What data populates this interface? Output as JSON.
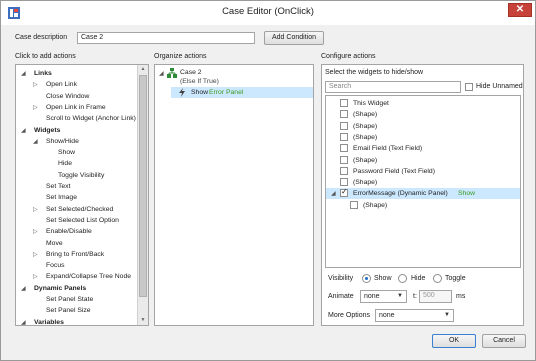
{
  "window": {
    "title": "Case Editor (OnClick)"
  },
  "case": {
    "description_label": "Case description",
    "description_value": "Case 2",
    "add_condition_label": "Add Condition"
  },
  "columns": {
    "left": "Click to add actions",
    "middle": "Organize actions",
    "right": "Configure actions"
  },
  "actions_tree": [
    {
      "label": "Links",
      "bold": true,
      "expander": "◢",
      "indent": 0
    },
    {
      "label": "Open Link",
      "expander": "▷",
      "indent": 1
    },
    {
      "label": "Close Window",
      "indent": 1
    },
    {
      "label": "Open Link in Frame",
      "expander": "▷",
      "indent": 1
    },
    {
      "label": "Scroll to Widget (Anchor Link)",
      "indent": 1
    },
    {
      "label": "Widgets",
      "bold": true,
      "expander": "◢",
      "indent": 0
    },
    {
      "label": "Show/Hide",
      "expander": "◢",
      "indent": 1
    },
    {
      "label": "Show",
      "indent": 2
    },
    {
      "label": "Hide",
      "indent": 2
    },
    {
      "label": "Toggle Visibility",
      "indent": 2
    },
    {
      "label": "Set Text",
      "indent": 1
    },
    {
      "label": "Set Image",
      "indent": 1
    },
    {
      "label": "Set Selected/Checked",
      "expander": "▷",
      "indent": 1
    },
    {
      "label": "Set Selected List Option",
      "indent": 1
    },
    {
      "label": "Enable/Disable",
      "expander": "▷",
      "indent": 1
    },
    {
      "label": "Move",
      "indent": 1
    },
    {
      "label": "Bring to Front/Back",
      "expander": "▷",
      "indent": 1
    },
    {
      "label": "Focus",
      "indent": 1
    },
    {
      "label": "Expand/Collapse Tree Node",
      "expander": "▷",
      "indent": 1
    },
    {
      "label": "Dynamic Panels",
      "bold": true,
      "expander": "◢",
      "indent": 0
    },
    {
      "label": "Set Panel State",
      "indent": 1
    },
    {
      "label": "Set Panel Size",
      "indent": 1
    },
    {
      "label": "Variables",
      "bold": true,
      "expander": "◢",
      "indent": 0
    }
  ],
  "organize": {
    "case_label": "Case 2",
    "case_sub": "(Else If True)",
    "action_verb": "Show",
    "action_target": "Error Panel"
  },
  "configure": {
    "select_label": "Select the widgets to hide/show",
    "search_placeholder": "Search",
    "hide_unnamed_label": "Hide Unnamed",
    "widgets": [
      {
        "label": "This Widget",
        "checked": false,
        "indent": 0
      },
      {
        "label": "(Shape)",
        "checked": false,
        "indent": 0
      },
      {
        "label": "(Shape)",
        "checked": false,
        "indent": 0
      },
      {
        "label": "(Shape)",
        "checked": false,
        "indent": 0
      },
      {
        "label": "Email Field (Text Field)",
        "checked": false,
        "indent": 0
      },
      {
        "label": "(Shape)",
        "checked": false,
        "indent": 0
      },
      {
        "label": "Password Field (Text Field)",
        "checked": false,
        "indent": 0
      },
      {
        "label": "(Shape)",
        "checked": false,
        "indent": 0
      },
      {
        "label": "ErrorMessage (Dynamic Panel)",
        "checked": true,
        "indent": 0,
        "expander": "◢",
        "suffix": "Show",
        "selected": true
      },
      {
        "label": "(Shape)",
        "checked": false,
        "indent": 1
      }
    ],
    "visibility_label": "Visibility",
    "visibility_options": [
      "Show",
      "Hide",
      "Toggle"
    ],
    "visibility_selected": "Show",
    "animate_label": "Animate",
    "animate_value": "none",
    "t_label": "t:",
    "t_value": "500",
    "ms_label": "ms",
    "more_options_label": "More Options",
    "more_options_value": "none"
  },
  "footer": {
    "ok_label": "OK",
    "cancel_label": "Cancel"
  },
  "colors": {
    "selection": "#cce8ff",
    "show_text": "#3a9a1e",
    "close": "#c7433a"
  }
}
